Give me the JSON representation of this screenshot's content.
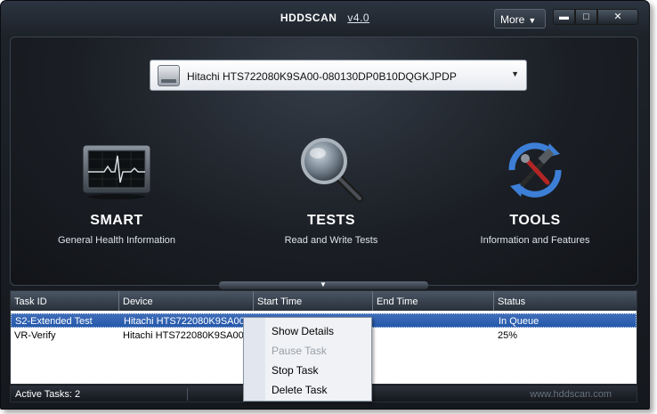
{
  "window": {
    "title": "HDDSCAN",
    "version": "v4.0",
    "more_label": "More",
    "minimize": "▬",
    "maximize": "□",
    "close": "✕"
  },
  "drive": {
    "selected": "Hitachi HTS722080K9SA00-080130DP0B10DQGKJPDP",
    "icon": "hard-drive-icon"
  },
  "features": [
    {
      "name": "SMART",
      "desc": "General Health Information",
      "icon": "health-monitor-icon"
    },
    {
      "name": "TESTS",
      "desc": "Read and Write Tests",
      "icon": "magnifier-icon"
    },
    {
      "name": "TOOLS",
      "desc": "Information and Features",
      "icon": "tools-icon"
    }
  ],
  "tasks": {
    "columns": [
      "Task ID",
      "Device",
      "Start Time",
      "End Time",
      "Status"
    ],
    "rows": [
      {
        "task_id": "S2-Extended Test",
        "device": "Hitachi HTS722080K9SA00-...",
        "start": "",
        "end": "",
        "status": "In Queue",
        "selected": true
      },
      {
        "task_id": "VR-Verify",
        "device": "Hitachi HTS722080K9SA00-...",
        "start": "",
        "end": "",
        "status": "25%",
        "selected": false
      }
    ]
  },
  "context_menu": {
    "items": [
      {
        "label": "Show Details",
        "enabled": true
      },
      {
        "label": "Pause Task",
        "enabled": false
      },
      {
        "label": "Stop Task",
        "enabled": true
      },
      {
        "label": "Delete Task",
        "enabled": true
      }
    ]
  },
  "status": {
    "active_tasks": "Active Tasks: 2",
    "site": "www.hddscan.com"
  },
  "colors": {
    "selection": "#2f62b1",
    "accent_blue": "#3d7fd6"
  }
}
